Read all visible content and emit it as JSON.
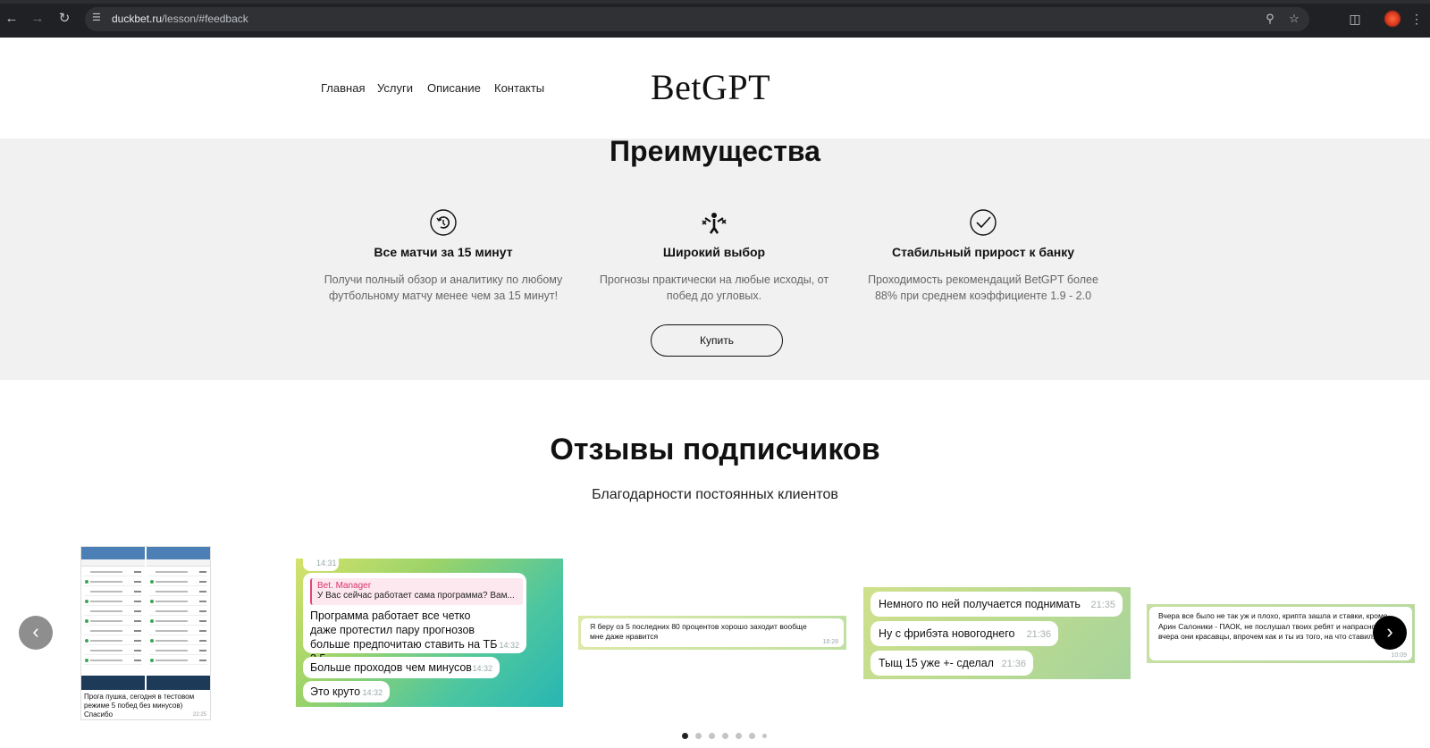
{
  "browser": {
    "url_host": "duckbet.ru",
    "url_path": "/lesson/#feedback",
    "icons": [
      "back-icon",
      "forward-icon",
      "reload-icon",
      "site-info-icon",
      "zoom-icon",
      "star-icon",
      "extensions-icon",
      "profile-icon"
    ]
  },
  "header": {
    "nav": [
      "Главная",
      "Услуги",
      "Описание",
      "Контакты"
    ],
    "logo": "BetGPT"
  },
  "advantages": {
    "title": "Преимущества",
    "features": [
      {
        "icon": "timer-icon",
        "title": "Все матчи за 15 минут",
        "desc": "Получи полный обзор и аналитику по любому футбольному матчу менее чем за 15 минут!"
      },
      {
        "icon": "choice-icon",
        "title": "Широкий выбор",
        "desc": "Прогнозы практически на любые исходы, от побед до угловых."
      },
      {
        "icon": "check-icon",
        "title": "Стабильный прирост к банку",
        "desc": "Проходимость рекомендаций BetGPT более 88% при среднем коэффициенте 1.9 - 2.0"
      }
    ],
    "buy_label": "Купить"
  },
  "reviews": {
    "title": "Отзывы подписчиков",
    "subtitle": "Благодарности постоянных клиентов",
    "card1": {
      "text": "Прога пушка, сегодня в тестовом режиме 5 побед без минусов) Спасибо",
      "time": "22:25"
    },
    "card2": {
      "top_time": "14:31",
      "reply_name": "Bet. Manager",
      "reply_text": "У Вас сейчас работает сама программа? Вам...",
      "messages": [
        {
          "text": "Программа работает все четко даже протестил пару прогнозов больше предпочитаю ставить на ТБ 2.5",
          "time": "14:32"
        },
        {
          "text": "Больше проходов чем минусов",
          "time": "14:32"
        },
        {
          "text": "Это круто",
          "time": "14:32"
        }
      ]
    },
    "card3": {
      "text": "Я беру оз 5 последних 80 процентов хорошо заходит вообще мне даже нравится",
      "time": "18:28"
    },
    "card4": {
      "messages": [
        {
          "text": "Немного по ней получается поднимать",
          "time": "21:35"
        },
        {
          "text": "Ну с фрибэта новогоднего",
          "time": "21:36"
        },
        {
          "text": "Тыщ 15 уже +- сделал",
          "time": "21:36"
        }
      ]
    },
    "card5": {
      "text": "Вчера все было не так уж и плохо, крипта зашла и ставки, кроме Арин Салоники - ПАОК, не послушал твоих ребят и напрасно, так за вчера они красавцы, впрочем как и ты из того, на что ставил.",
      "time": "10:09"
    },
    "prev_arrow": "‹",
    "next_arrow": "›",
    "page_count": 7,
    "active_page": 1
  },
  "colors": {
    "chrome_bg": "#202124",
    "section_gray": "#f1f1f1",
    "prev_arrow_bg": "#8e8e8e",
    "next_arrow_bg": "#000000",
    "dot_active": "#222222",
    "dot_inactive": "#c4c4c4"
  }
}
